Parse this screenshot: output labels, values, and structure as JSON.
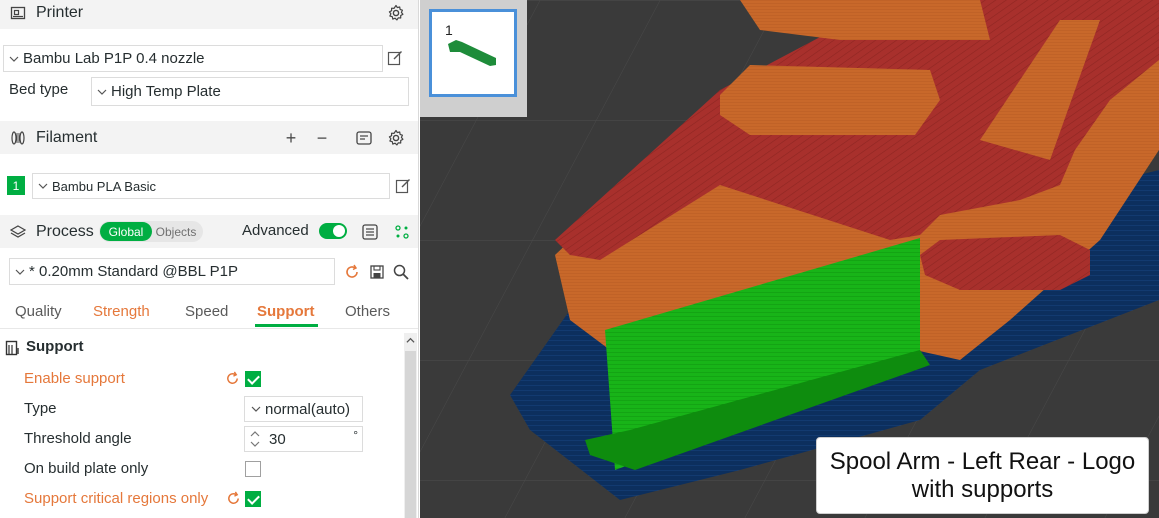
{
  "printer": {
    "section_title": "Printer",
    "preset": "Bambu Lab P1P 0.4 nozzle",
    "bed_type_label": "Bed type",
    "bed_type_value": "High Temp Plate"
  },
  "filament": {
    "section_title": "Filament",
    "slot_number": "1",
    "slot_color": "#00ae42",
    "preset": "Bambu PLA Basic"
  },
  "process": {
    "section_title": "Process",
    "mode_global": "Global",
    "mode_objects": "Objects",
    "advanced_label": "Advanced",
    "advanced_on": true,
    "preset": "* 0.20mm Standard @BBL P1P",
    "tabs": [
      {
        "label": "Quality"
      },
      {
        "label": "Strength"
      },
      {
        "label": "Speed"
      },
      {
        "label": "Support"
      },
      {
        "label": "Others"
      }
    ],
    "active_tab": "Support"
  },
  "support": {
    "group_title": "Support",
    "enable_support_label": "Enable support",
    "enable_support_checked": true,
    "type_label": "Type",
    "type_value": "normal(auto)",
    "threshold_label": "Threshold angle",
    "threshold_value": "30",
    "threshold_unit": "°",
    "build_plate_only_label": "On build plate only",
    "build_plate_only_checked": false,
    "critical_regions_label": "Support critical regions only",
    "critical_regions_checked": true
  },
  "viewport": {
    "plate_number": "1",
    "caption_line1": "Spool Arm - Left Rear - Logo",
    "caption_line2": "with supports"
  },
  "colors": {
    "accent_green": "#00ae42",
    "modified_orange": "#e5783b",
    "wall_orange": "#c8682a",
    "top_red": "#a8302c",
    "brim_blue": "#0c2f5e",
    "support_green": "#18b418",
    "bed_dark": "#3a3a3a"
  }
}
